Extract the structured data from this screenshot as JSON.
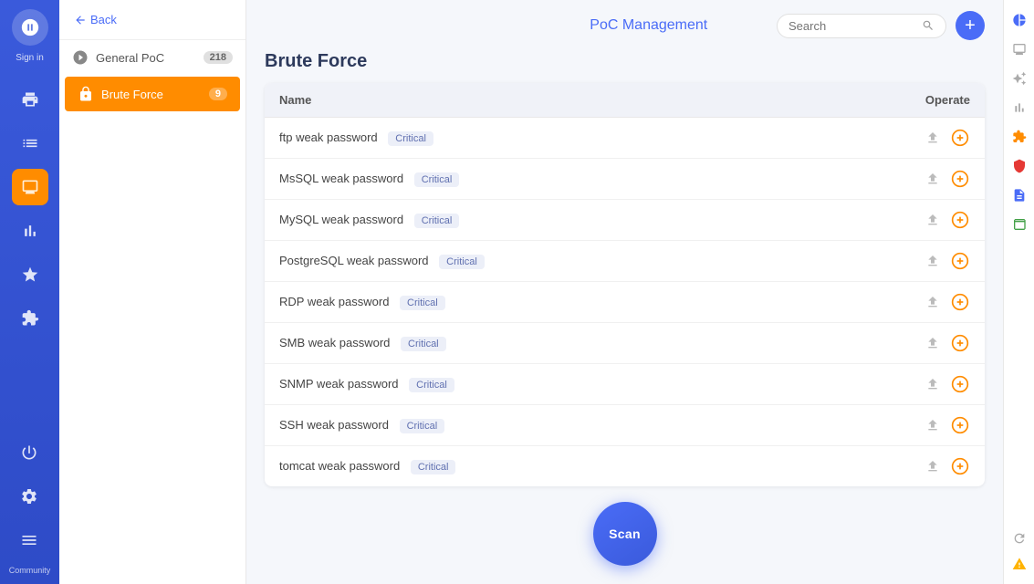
{
  "app": {
    "title": "PoC Management",
    "sign_in_label": "Sign in"
  },
  "header": {
    "back_label": "Back",
    "search_placeholder": "Search",
    "add_label": "+"
  },
  "nav": {
    "general_poc_label": "General PoC",
    "general_poc_count": "218",
    "brute_force_label": "Brute Force",
    "brute_force_count": "9"
  },
  "page": {
    "heading": "Brute Force"
  },
  "table": {
    "col_name": "Name",
    "col_operate": "Operate",
    "rows": [
      {
        "name": "ftp weak password",
        "severity": "Critical"
      },
      {
        "name": "MsSQL weak password",
        "severity": "Critical"
      },
      {
        "name": "MySQL weak password",
        "severity": "Critical"
      },
      {
        "name": "PostgreSQL weak password",
        "severity": "Critical"
      },
      {
        "name": "RDP weak password",
        "severity": "Critical"
      },
      {
        "name": "SMB weak password",
        "severity": "Critical"
      },
      {
        "name": "SNMP weak password",
        "severity": "Critical"
      },
      {
        "name": "SSH weak password",
        "severity": "Critical"
      },
      {
        "name": "tomcat weak password",
        "severity": "Critical"
      }
    ]
  },
  "scan_button": {
    "label": "Scan"
  },
  "left_sidebar": {
    "icons": [
      "compass",
      "printer",
      "list",
      "monitor",
      "star",
      "puzzle",
      "settings",
      "community"
    ]
  },
  "right_sidebar": {
    "icons": [
      "chart-pie",
      "screen",
      "sparkle",
      "bar-chart",
      "puzzle",
      "shield",
      "document",
      "grid",
      "refresh",
      "warning"
    ]
  }
}
